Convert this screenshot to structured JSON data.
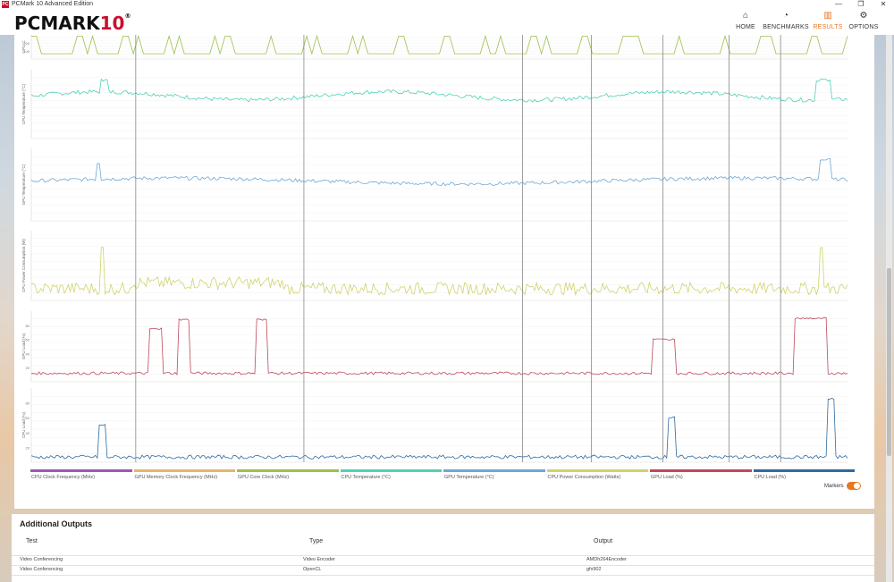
{
  "window": {
    "title": "PCMark 10 Advanced Edition",
    "logo_mini": "PC",
    "controls": [
      "—",
      "❐",
      "✕"
    ]
  },
  "brand": {
    "name": "PCMARK",
    "version": "10",
    "reg": "®"
  },
  "nav": [
    {
      "label": "HOME",
      "icon": "⌂",
      "active": false
    },
    {
      "label": "BENCHMARKS",
      "icon": "◔",
      "active": false
    },
    {
      "label": "RESULTS",
      "icon": "▥",
      "active": true
    },
    {
      "label": "OPTIONS",
      "icon": "⚙",
      "active": false
    }
  ],
  "chart_data": {
    "type": "line",
    "panels": [
      {
        "ylabel": "GPU C",
        "ticks": [
          "200",
          "100"
        ],
        "color": "#9cc04a"
      },
      {
        "ylabel": "CPU Temperature (°C)",
        "ticks": [],
        "color": "#4fd1b5"
      },
      {
        "ylabel": "GPU Temperature (°C)",
        "ticks": [],
        "color": "#6fa8d6"
      },
      {
        "ylabel": "CPU Power Consumption (W)",
        "ticks": [],
        "color": "#cfd36a"
      },
      {
        "ylabel": "GPU Load (%)",
        "ticks": [
          "80",
          "60",
          "40",
          "20"
        ],
        "color": "#c0485a"
      },
      {
        "ylabel": "CPU Load (%)",
        "ticks": [
          "80",
          "60",
          "40",
          "20"
        ],
        "color": "#2e6aa0"
      }
    ],
    "legend": [
      {
        "name": "CPU Clock Frequency (MHz)",
        "color": "#9b59b6"
      },
      {
        "name": "GPU Memory Clock Frequency (MHz)",
        "color": "#e3b76b"
      },
      {
        "name": "GPU Core Clock (MHz)",
        "color": "#9cc04a"
      },
      {
        "name": "CPU Temperature (°C)",
        "color": "#4fd1b5"
      },
      {
        "name": "GPU Temperature (°C)",
        "color": "#6fa8d6"
      },
      {
        "name": "CPU Power Consumption (Watts)",
        "color": "#cfd36a"
      },
      {
        "name": "GPU Load (%)",
        "color": "#c0485a"
      },
      {
        "name": "CPU Load (%)",
        "color": "#2e6aa0"
      }
    ],
    "marker_positions": [
      0.128,
      0.334,
      0.602,
      0.686,
      0.774,
      0.855,
      0.918
    ]
  },
  "markers": {
    "label": "Markers",
    "on": true
  },
  "outputs": {
    "title": "Additional Outputs",
    "headers": [
      "Test",
      "Type",
      "Output"
    ],
    "rows": [
      [
        "Video Conferencing",
        "Video Encoder",
        "AMDh264Encoder"
      ],
      [
        "Video Conferencing",
        "OpenCL",
        "gfx902"
      ]
    ]
  }
}
